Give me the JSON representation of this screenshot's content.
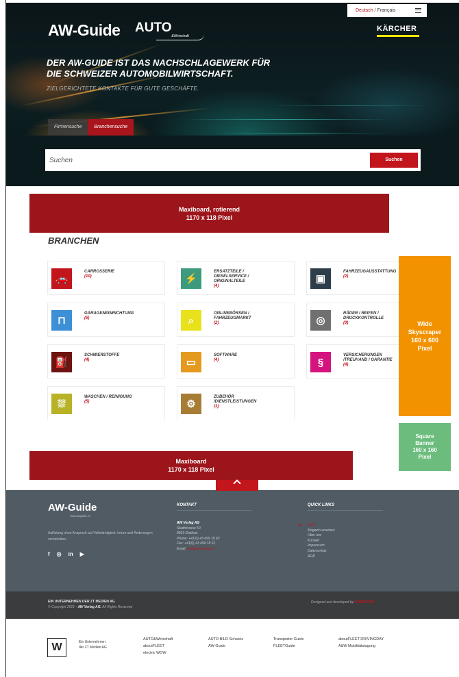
{
  "language": {
    "de": "Deutsch",
    "separator": "/",
    "fr": "Français"
  },
  "header": {
    "logo_aw": "AW-Guide",
    "logo_auto": "AUTO",
    "logo_auto_sub": "&Wirtschaft",
    "logo_kaercher": "KÄRCHER",
    "headline_line1": "DER AW-GUIDE IST DAS NACHSCHLAGEWERK FÜR",
    "headline_line2": "DIE SCHWEIZER AUTOMOBILWIRTSCHAFT.",
    "subline": "ZIELGERICHTETE KONTAKTE FÜR GUTE GESCHÄFTE."
  },
  "tabs": [
    {
      "label": "Firmensuche"
    },
    {
      "label": "Branchensuche"
    }
  ],
  "search": {
    "placeholder": "Suchen",
    "value": "",
    "button": "Suchen"
  },
  "ads": {
    "top": {
      "line1": "Maxiboard, rotierend",
      "line2": "1170 x 118 Pixel"
    },
    "bottom": {
      "line1": "Maxiboard",
      "line2": "1170 x 118 Pixel"
    },
    "sky": {
      "line1": "Wide",
      "line2": "Skyscraper",
      "line3": "160 x 600",
      "line4": "Pixel"
    },
    "square": {
      "line1": "Square",
      "line2": "Banner",
      "line3": "160 x 160",
      "line4": "Pixel"
    }
  },
  "branchen": {
    "title": "BRANCHEN",
    "items": [
      {
        "name_lines": [
          "CARROSSERIE"
        ],
        "count": "(10)",
        "color": "#c3151c",
        "icon": "car-body-icon",
        "glyph": "🚗"
      },
      {
        "name_lines": [
          "ERSATZTEILE /",
          "DIESELSERVICE /",
          "ORIGINALTEILE"
        ],
        "count": "(4)",
        "color": "#3c9b7e",
        "icon": "spark-plug-icon",
        "glyph": "⚡"
      },
      {
        "name_lines": [
          "FAHRZEUGAUSSTATTUNG"
        ],
        "count": "(2)",
        "color": "#2d3e4a",
        "icon": "car-seat-icon",
        "glyph": "▣"
      },
      {
        "name_lines": [
          "GARAGENEINRICHTUNG"
        ],
        "count": "(5)",
        "color": "#3d8fd6",
        "icon": "car-lift-icon",
        "glyph": "⊓"
      },
      {
        "name_lines": [
          "ONLINEBÖRSEN /",
          "FAHRZEUGMARKT"
        ],
        "count": "(2)",
        "color": "#e9e21b",
        "icon": "magnifier-icon",
        "glyph": "⌕"
      },
      {
        "name_lines": [
          "RÄDER / REIFEN /",
          "DRUCKKONTROLLE"
        ],
        "count": "(9)",
        "color": "#707070",
        "icon": "tire-icon",
        "glyph": "◎"
      },
      {
        "name_lines": [
          "SCHMIERSTOFFE"
        ],
        "count": "(4)",
        "color": "#6d1410",
        "icon": "oil-can-icon",
        "glyph": "⛽"
      },
      {
        "name_lines": [
          "SOFTWARE"
        ],
        "count": "(4)",
        "color": "#e49a1e",
        "icon": "car-screen-icon",
        "glyph": "▭"
      },
      {
        "name_lines": [
          "VERSICHERUNGEN",
          "/TREUHAND / GARANTIE"
        ],
        "count": "(4)",
        "color": "#d5157f",
        "icon": "paragraph-icon",
        "glyph": "§"
      },
      {
        "name_lines": [
          "WASCHEN / REINIGUNG"
        ],
        "count": "(5)",
        "color": "#b7b226",
        "icon": "car-wash-icon",
        "glyph": "⛆"
      },
      {
        "name_lines": [
          "ZUBEHÖR",
          "/DIENSTLEISTUNGEN"
        ],
        "count": "(3)",
        "color": "#a77d36",
        "icon": "service-icon",
        "glyph": "⚙"
      }
    ]
  },
  "footer": {
    "logo": "AW-Guide",
    "logo_sub": "www.awguide.ch",
    "text": "Auflistung ohne Anspruch auf Vollständigkeit. Irrtum und Änderungen vorbehalten.",
    "social": [
      {
        "icon": "facebook-icon",
        "glyph": "f"
      },
      {
        "icon": "instagram-icon",
        "glyph": "◎"
      },
      {
        "icon": "linkedin-icon",
        "glyph": "in"
      },
      {
        "icon": "youtube-icon",
        "glyph": "▶"
      }
    ],
    "kontakt_title": "KONTAKT",
    "kontakt": {
      "company": "AW Verlag AG",
      "street": "Stadtstrasse 50",
      "city": "8953 Dietikon",
      "phone": "Phone: +41(0) 43 499 18 60",
      "fax": "Fax: +41(0) 43 499 18 61",
      "email_label": "Email:",
      "email": "info@awverlag.ch"
    },
    "quicklinks_title": "QUICK LINKS",
    "quicklinks": [
      "Start",
      "Magazin ansehen",
      "Über uns",
      "Kontakt",
      "Impressum",
      "Datenschutz",
      "AGB"
    ]
  },
  "bar": {
    "line1": "EIN UNTERNEHMEN DER ZT MEDIEN AG",
    "copyright": "© Copyright 2021 -",
    "company": "AW Verlag AG.",
    "rights": "All Rights Reserved",
    "designed": "Designed and developed by",
    "agency": "OVERFLOW"
  },
  "bottom": {
    "logo_glyph": "W",
    "company_line1": "Ein Unternehmen",
    "company_line2": "der ZT Medien AG",
    "col1": [
      "AUTO&Wirtschaft",
      "aboutFLEET",
      "electric WOW"
    ],
    "col2": [
      "AUTO BILD Schweiz",
      "AW-Guide"
    ],
    "col3": [
      "Transporter Guide",
      "FLEETGuide"
    ],
    "col4": [
      "aboutFLEET DRIVINGDAY",
      "A&W Mobilitätstagung"
    ]
  }
}
